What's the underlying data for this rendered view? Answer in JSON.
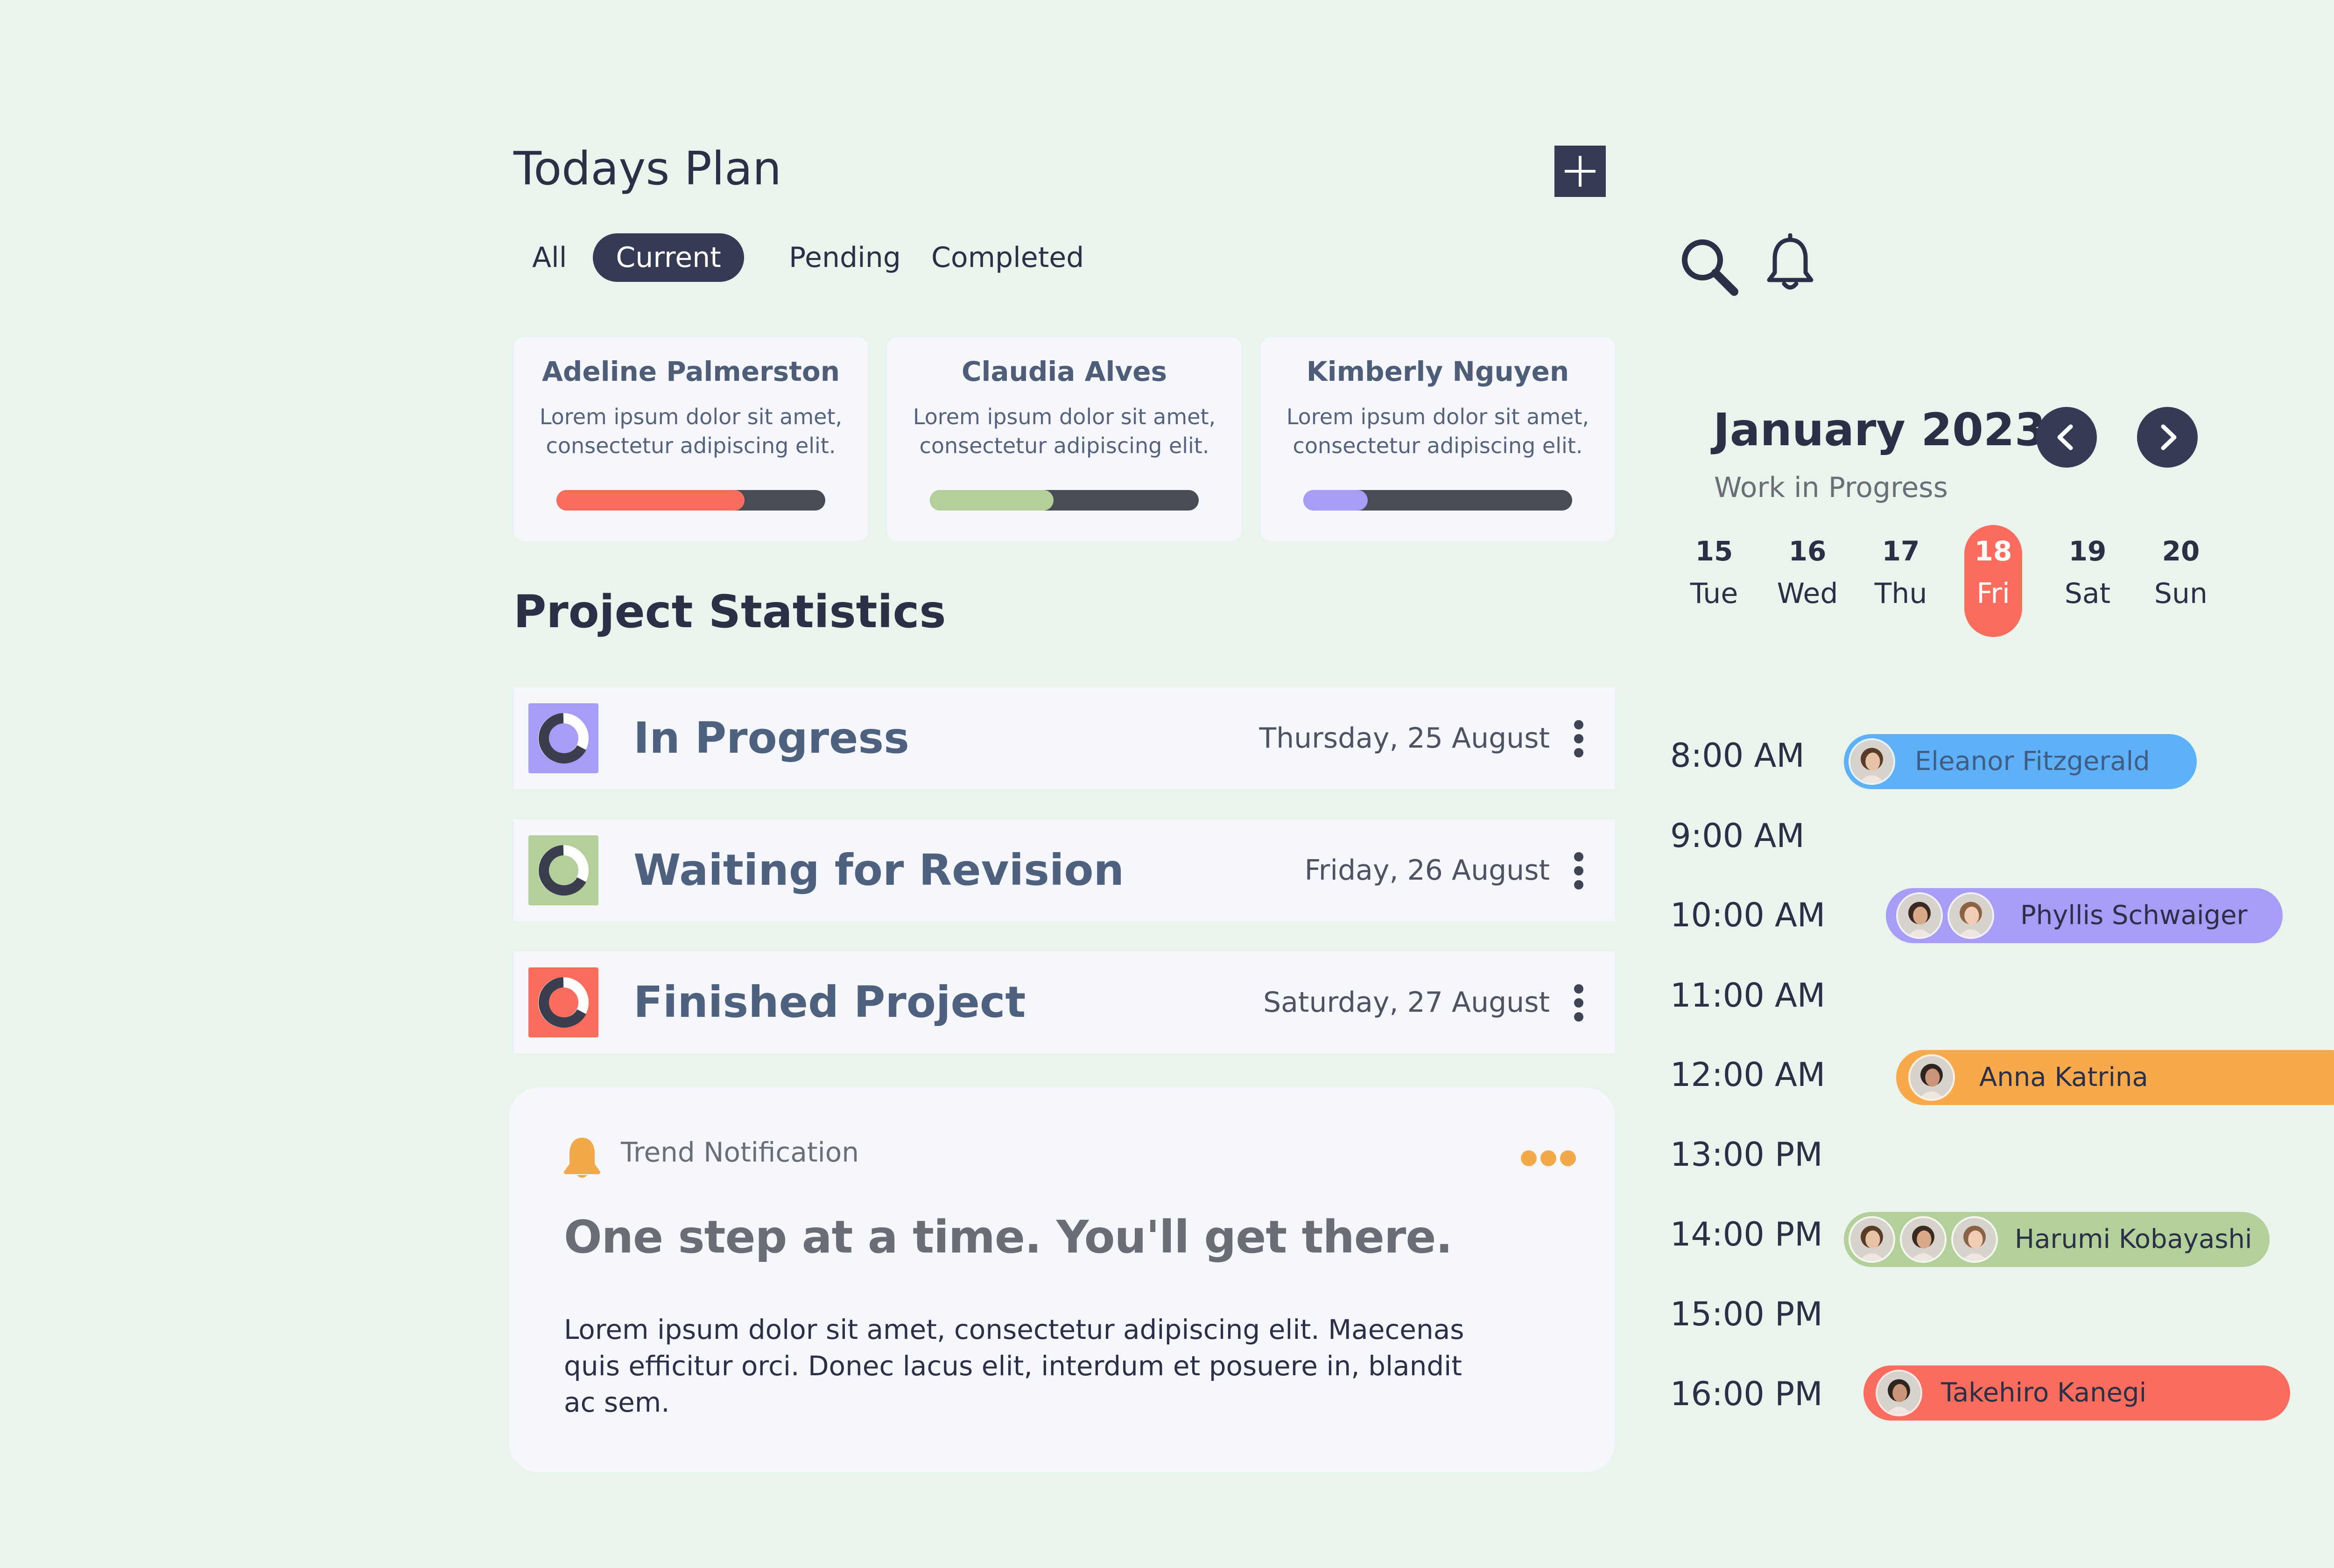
{
  "header": {
    "title": "Todays Plan",
    "add_icon": "plus-icon"
  },
  "filters": [
    "All",
    "Current",
    "Pending",
    "Completed"
  ],
  "active_filter": "Current",
  "people": [
    {
      "name": "Adeline Palmerston",
      "text": "Lorem ipsum dolor sit amet, consectetur adipiscing elit.",
      "progress": 0.7,
      "color": "#fa6d5e"
    },
    {
      "name": "Claudia Alves",
      "text": "Lorem ipsum dolor sit amet, consectetur adipiscing elit.",
      "progress": 0.46,
      "color": "#b3d09a"
    },
    {
      "name": "Kimberly Nguyen",
      "text": "Lorem ipsum dolor sit amet, consectetur adipiscing elit.",
      "progress": 0.24,
      "color": "#a79cf6"
    }
  ],
  "statistics": {
    "title": "Project Statistics",
    "items": [
      {
        "label": "In Progress",
        "date": "Thursday, 25 August",
        "color": "#a79cf6",
        "icon": "donut-chart-icon"
      },
      {
        "label": "Waiting for Revision",
        "date": "Friday, 26 August",
        "color": "#b3d09a",
        "icon": "donut-chart-icon"
      },
      {
        "label": "Finished Project",
        "date": "Saturday, 27 August",
        "color": "#fa6d5e",
        "icon": "donut-chart-icon"
      }
    ]
  },
  "notification": {
    "label": "Trend Notification",
    "headline": "One step at a time. You'll get there.",
    "body": "Lorem ipsum dolor sit amet, consectetur adipiscing elit. Maecenas quis efficitur orci. Donec lacus elit, interdum et posuere in, blandit ac sem.",
    "accent": "#f2a94a"
  },
  "calendar": {
    "month": "January 2023",
    "subtitle": "Work in Progress",
    "days": [
      {
        "num": "15",
        "wd": "Tue"
      },
      {
        "num": "16",
        "wd": "Wed"
      },
      {
        "num": "17",
        "wd": "Thu"
      },
      {
        "num": "18",
        "wd": "Fri",
        "selected": true
      },
      {
        "num": "19",
        "wd": "Sat"
      },
      {
        "num": "20",
        "wd": "Sun"
      }
    ],
    "selected_color": "#fa6d5e"
  },
  "schedule": {
    "times": [
      "8:00 AM",
      "9:00 AM",
      "10:00 AM",
      "11:00 AM",
      "12:00 AM",
      "13:00 PM",
      "14:00 PM",
      "15:00 PM",
      "16:00 PM"
    ],
    "events": [
      {
        "name": "Eleanor Fitzgerald",
        "color": "#5fb1f7",
        "time": "8:00 AM",
        "avatars": 1
      },
      {
        "name": "Phyllis Schwaiger",
        "color": "#a79cf6",
        "time": "10:00 AM",
        "avatars": 2
      },
      {
        "name": "Anna Katrina",
        "color": "#f7a94c",
        "time": "12:00 AM",
        "avatars": 1
      },
      {
        "name": "Harumi Kobayashi",
        "color": "#b3d09a",
        "time": "14:00 PM",
        "avatars": 3
      },
      {
        "name": "Takehiro Kanegi",
        "color": "#fa6d5e",
        "time": "16:00 PM",
        "avatars": 1
      }
    ]
  }
}
